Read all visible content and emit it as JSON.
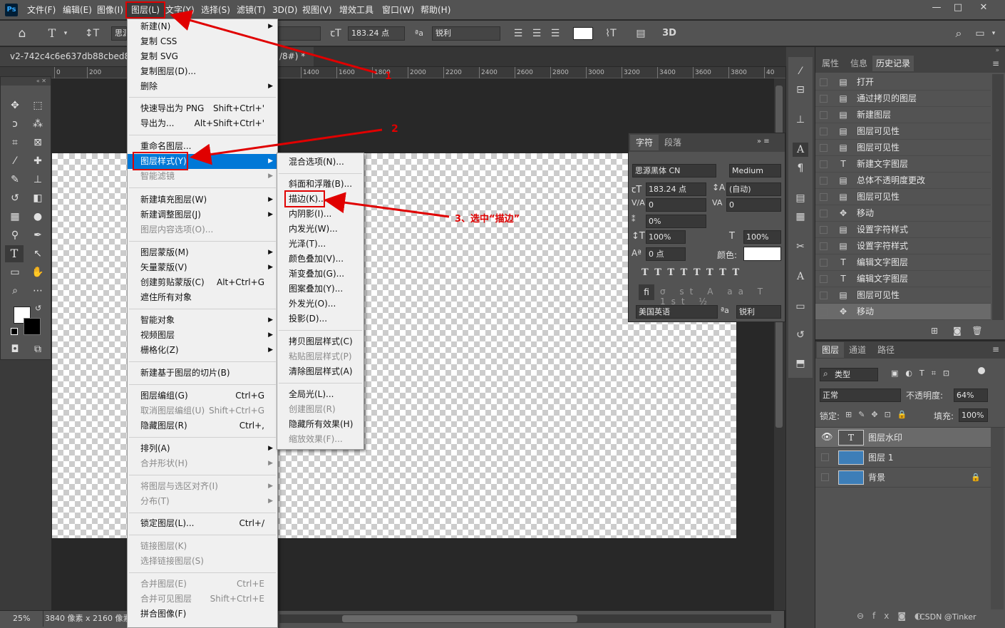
{
  "menubar": {
    "logo": "Ps",
    "items": [
      "文件(F)",
      "编辑(E)",
      "图像(I)",
      "图层(L)",
      "文字(Y)",
      "选择(S)",
      "滤镜(T)",
      "3D(D)",
      "视图(V)",
      "增效工具",
      "窗口(W)",
      "帮助(H)"
    ],
    "win": [
      "—",
      "□",
      "✕"
    ]
  },
  "options": {
    "font_size": "183.24 点",
    "aa": "锐利",
    "font_partial": "思源",
    "threeD": "3D"
  },
  "doc": {
    "tab": "v2-742c4c6e637db88cbed8401",
    "tab_suffix": "/8#) *",
    "zoom": "25%",
    "size": "3840 像素 x 2160 像素"
  },
  "ruler_ticks": [
    "200",
    "0",
    "200",
    "1400",
    "1600",
    "1800",
    "2000",
    "2200",
    "2400",
    "2600",
    "2800",
    "3000",
    "3200",
    "3400",
    "3600",
    "3800",
    "40"
  ],
  "layer_menu": {
    "items": [
      {
        "label": "新建(N)",
        "sc": "",
        "arrow": true,
        "dis": false
      },
      {
        "label": "复制 CSS",
        "sc": "",
        "arrow": false,
        "dis": false
      },
      {
        "label": "复制 SVG",
        "sc": "",
        "arrow": false,
        "dis": false
      },
      {
        "label": "复制图层(D)...",
        "sc": "",
        "arrow": false,
        "dis": false
      },
      {
        "label": "删除",
        "sc": "",
        "arrow": true,
        "dis": false
      },
      {
        "label": "快速导出为 PNG",
        "sc": "Shift+Ctrl+'",
        "arrow": false,
        "dis": false
      },
      {
        "label": "导出为...",
        "sc": "Alt+Shift+Ctrl+'",
        "arrow": false,
        "dis": false
      },
      {
        "label": "重命名图层...",
        "sc": "",
        "arrow": false,
        "dis": false
      },
      {
        "label": "图层样式(Y)",
        "sc": "",
        "arrow": true,
        "dis": false,
        "sel": true
      },
      {
        "label": "智能滤镜",
        "sc": "",
        "arrow": true,
        "dis": true
      },
      {
        "label": "新建填充图层(W)",
        "sc": "",
        "arrow": true,
        "dis": false
      },
      {
        "label": "新建调整图层(J)",
        "sc": "",
        "arrow": true,
        "dis": false
      },
      {
        "label": "图层内容选项(O)...",
        "sc": "",
        "arrow": false,
        "dis": true
      },
      {
        "label": "图层蒙版(M)",
        "sc": "",
        "arrow": true,
        "dis": false
      },
      {
        "label": "矢量蒙版(V)",
        "sc": "",
        "arrow": true,
        "dis": false
      },
      {
        "label": "创建剪贴蒙版(C)",
        "sc": "Alt+Ctrl+G",
        "arrow": false,
        "dis": false
      },
      {
        "label": "遮住所有对象",
        "sc": "",
        "arrow": false,
        "dis": false
      },
      {
        "label": "智能对象",
        "sc": "",
        "arrow": true,
        "dis": false
      },
      {
        "label": "视频图层",
        "sc": "",
        "arrow": true,
        "dis": false
      },
      {
        "label": "栅格化(Z)",
        "sc": "",
        "arrow": true,
        "dis": false
      },
      {
        "label": "新建基于图层的切片(B)",
        "sc": "",
        "arrow": false,
        "dis": false
      },
      {
        "label": "图层编组(G)",
        "sc": "Ctrl+G",
        "arrow": false,
        "dis": false
      },
      {
        "label": "取消图层编组(U)",
        "sc": "Shift+Ctrl+G",
        "arrow": false,
        "dis": true
      },
      {
        "label": "隐藏图层(R)",
        "sc": "Ctrl+,",
        "arrow": false,
        "dis": false
      },
      {
        "label": "排列(A)",
        "sc": "",
        "arrow": true,
        "dis": false
      },
      {
        "label": "合并形状(H)",
        "sc": "",
        "arrow": true,
        "dis": true
      },
      {
        "label": "将图层与选区对齐(I)",
        "sc": "",
        "arrow": true,
        "dis": true
      },
      {
        "label": "分布(T)",
        "sc": "",
        "arrow": true,
        "dis": true
      },
      {
        "label": "锁定图层(L)...",
        "sc": "Ctrl+/",
        "arrow": false,
        "dis": false
      },
      {
        "label": "链接图层(K)",
        "sc": "",
        "arrow": false,
        "dis": true
      },
      {
        "label": "选择链接图层(S)",
        "sc": "",
        "arrow": false,
        "dis": true
      },
      {
        "label": "合并图层(E)",
        "sc": "Ctrl+E",
        "arrow": false,
        "dis": true
      },
      {
        "label": "合并可见图层",
        "sc": "Shift+Ctrl+E",
        "arrow": false,
        "dis": true
      },
      {
        "label": "拼合图像(F)",
        "sc": "",
        "arrow": false,
        "dis": false
      }
    ]
  },
  "style_menu": {
    "items": [
      {
        "label": "混合选项(N)...",
        "dis": false
      },
      {
        "label": "斜面和浮雕(B)...",
        "dis": false
      },
      {
        "label": "描边(K)...",
        "dis": false
      },
      {
        "label": "内阴影(I)...",
        "dis": false
      },
      {
        "label": "内发光(W)...",
        "dis": false
      },
      {
        "label": "光泽(T)...",
        "dis": false
      },
      {
        "label": "颜色叠加(V)...",
        "dis": false
      },
      {
        "label": "渐变叠加(G)...",
        "dis": false
      },
      {
        "label": "图案叠加(Y)...",
        "dis": false
      },
      {
        "label": "外发光(O)...",
        "dis": false
      },
      {
        "label": "投影(D)...",
        "dis": false
      },
      {
        "label": "拷贝图层样式(C)",
        "dis": false
      },
      {
        "label": "粘贴图层样式(P)",
        "dis": true
      },
      {
        "label": "清除图层样式(A)",
        "dis": false
      },
      {
        "label": "全局光(L)...",
        "dis": false
      },
      {
        "label": "创建图层(R)",
        "dis": true
      },
      {
        "label": "隐藏所有效果(H)",
        "dis": false
      },
      {
        "label": "缩放效果(F)...",
        "dis": true
      }
    ]
  },
  "annotations": {
    "a1": "1",
    "a2": "2",
    "a3": "3、选中“描边”"
  },
  "char_panel": {
    "tab1": "字符",
    "tab2": "段落",
    "font": "思源黑体 CN",
    "weight": "Medium",
    "size": "183.24 点",
    "leading": "(自动)",
    "kern": "0",
    "track": "0",
    "scale_pct": "0%",
    "vscale": "100%",
    "hscale": "100%",
    "baseline": "0 点",
    "color_label": "颜色:",
    "lang": "美国英语",
    "aa": "锐利"
  },
  "history": {
    "tabs": [
      "属性",
      "信息",
      "历史记录"
    ],
    "items": [
      {
        "icon": "▤",
        "label": "打开"
      },
      {
        "icon": "▤",
        "label": "通过拷贝的图层"
      },
      {
        "icon": "▤",
        "label": "新建图层"
      },
      {
        "icon": "▤",
        "label": "图层可见性"
      },
      {
        "icon": "▤",
        "label": "图层可见性"
      },
      {
        "icon": "T",
        "label": "新建文字图层"
      },
      {
        "icon": "▤",
        "label": "总体不透明度更改"
      },
      {
        "icon": "▤",
        "label": "图层可见性"
      },
      {
        "icon": "✥",
        "label": "移动"
      },
      {
        "icon": "▤",
        "label": "设置字符样式"
      },
      {
        "icon": "▤",
        "label": "设置字符样式"
      },
      {
        "icon": "T",
        "label": "编辑文字图层"
      },
      {
        "icon": "T",
        "label": "编辑文字图层"
      },
      {
        "icon": "▤",
        "label": "图层可见性"
      },
      {
        "icon": "✥",
        "label": "移动"
      }
    ]
  },
  "layers": {
    "tabs": [
      "图层",
      "通道",
      "路径"
    ],
    "filter": "类型",
    "blend": "正常",
    "opacity_label": "不透明度:",
    "opacity": "64%",
    "lock_label": "锁定:",
    "fill_label": "填充:",
    "fill": "100%",
    "rows": [
      {
        "name": "图层水印",
        "type": "text"
      },
      {
        "name": "图层 1",
        "type": "image"
      },
      {
        "name": "背景",
        "type": "image"
      }
    ],
    "watermark": "CSDN @Tinker"
  }
}
